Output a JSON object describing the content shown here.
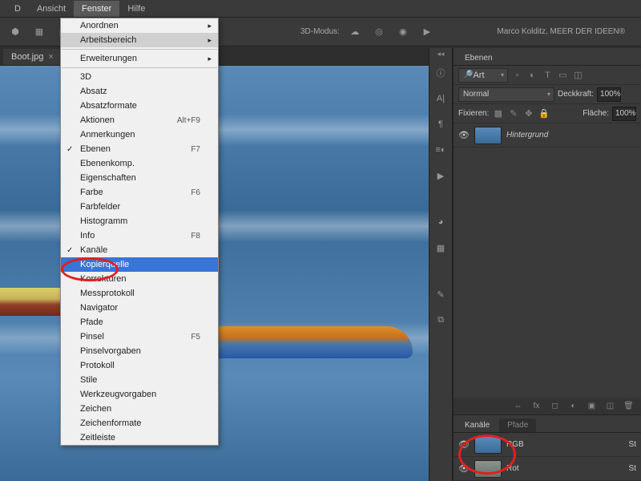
{
  "menubar": {
    "items": [
      {
        "label": "Ansicht"
      },
      {
        "label": "Fenster",
        "active": true
      },
      {
        "label": "Hilfe"
      }
    ]
  },
  "toolbar": {
    "mode_label": "3D-Modus:",
    "brand": "Marco Kolditz, MEER DER IDEEN®"
  },
  "document": {
    "tab_label": "Boot.jpg"
  },
  "dropdown": {
    "items": [
      {
        "label": "Anordnen",
        "sub": true
      },
      {
        "label": "Arbeitsbereich",
        "sub": true,
        "hl_sub": true
      },
      {
        "sep": true
      },
      {
        "label": "Erweiterungen",
        "sub": true
      },
      {
        "sep": true
      },
      {
        "label": "3D"
      },
      {
        "label": "Absatz"
      },
      {
        "label": "Absatzformate"
      },
      {
        "label": "Aktionen",
        "shortcut": "Alt+F9"
      },
      {
        "label": "Anmerkungen"
      },
      {
        "label": "Ebenen",
        "checked": true,
        "shortcut": "F7"
      },
      {
        "label": "Ebenenkomp."
      },
      {
        "label": "Eigenschaften"
      },
      {
        "label": "Farbe",
        "shortcut": "F6"
      },
      {
        "label": "Farbfelder"
      },
      {
        "label": "Histogramm"
      },
      {
        "label": "Info",
        "shortcut": "F8"
      },
      {
        "label": "Kanäle",
        "checked": true
      },
      {
        "label": "Kopierquelle",
        "hl": true
      },
      {
        "label": "Korrekturen"
      },
      {
        "label": "Messprotokoll"
      },
      {
        "label": "Navigator"
      },
      {
        "label": "Pfade"
      },
      {
        "label": "Pinsel",
        "shortcut": "F5"
      },
      {
        "label": "Pinselvorgaben"
      },
      {
        "label": "Protokoll"
      },
      {
        "label": "Stile"
      },
      {
        "label": "Werkzeugvorgaben"
      },
      {
        "label": "Zeichen"
      },
      {
        "label": "Zeichenformate"
      },
      {
        "label": "Zeitleiste"
      }
    ]
  },
  "layers_panel": {
    "tab": "Ebenen",
    "filter_label": "Art",
    "blend_mode": "Normal",
    "opacity_label": "Deckkraft:",
    "opacity_value": "100%",
    "lock_label": "Fixieren:",
    "fill_label": "Fläche:",
    "fill_value": "100%",
    "layers": [
      {
        "name": "Hintergrund"
      }
    ]
  },
  "channels_panel": {
    "tabs": [
      "Kanäle",
      "Pfade"
    ],
    "channels": [
      {
        "name": "RGB",
        "shortcut": "St"
      },
      {
        "name": "Rot",
        "shortcut": "St"
      }
    ]
  }
}
